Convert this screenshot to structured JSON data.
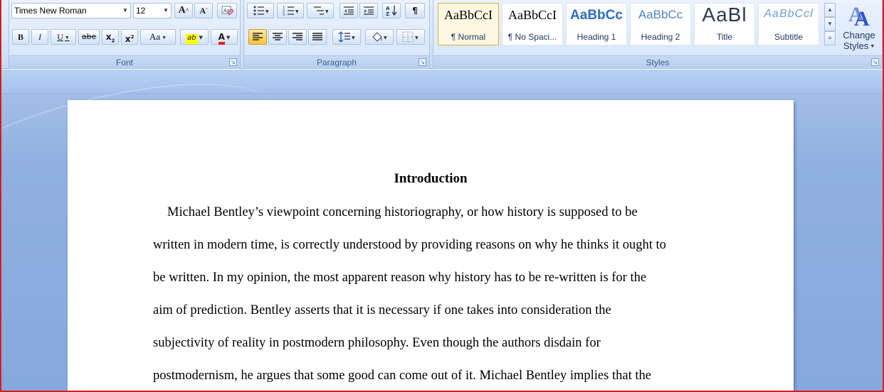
{
  "ribbon": {
    "font_group": {
      "label": "Font",
      "font_name": "Times New Roman",
      "font_size": "12",
      "grow_font": "A",
      "shrink_font": "A",
      "bold": "B",
      "italic": "I",
      "underline": "U",
      "strikethrough": "abe",
      "subscript": "x",
      "superscript": "x",
      "change_case": "Aa",
      "highlight": "ab",
      "font_color": "A"
    },
    "paragraph_group": {
      "label": "Paragraph",
      "show_marks": "¶"
    },
    "styles_group": {
      "label": "Styles",
      "tiles": [
        {
          "sample": "AaBbCcI",
          "name": "¶ Normal"
        },
        {
          "sample": "AaBbCcI",
          "name": "¶ No Spaci..."
        },
        {
          "sample": "AaBbCc",
          "name": "Heading 1"
        },
        {
          "sample": "AaBbCc",
          "name": "Heading 2"
        },
        {
          "sample": "AaBl",
          "name": "Title"
        },
        {
          "sample": "AaBbCcl",
          "name": "Subtitle"
        }
      ],
      "change_styles_line1": "Change",
      "change_styles_line2": "Styles"
    }
  },
  "colors": {
    "highlight": "#ffff00",
    "font_color": "#e0201c",
    "heading": "#2e6cc0",
    "frame": "#d21f1f"
  },
  "document": {
    "title": "Introduction",
    "lines": [
      "Michael Bentley’s viewpoint concerning historiography, or how history is supposed to be",
      "written in modern time, is correctly understood by providing reasons on why he thinks it ought to",
      "be written. In my opinion, the most apparent reason why history has to be re-written is for the",
      "aim of prediction. Bentley asserts that it is necessary if one takes into consideration the",
      "subjectivity of reality in postmodern philosophy. Even though the authors disdain for",
      "postmodernism, he argues that some good can come out of it. Michael Bentley implies that the"
    ]
  }
}
